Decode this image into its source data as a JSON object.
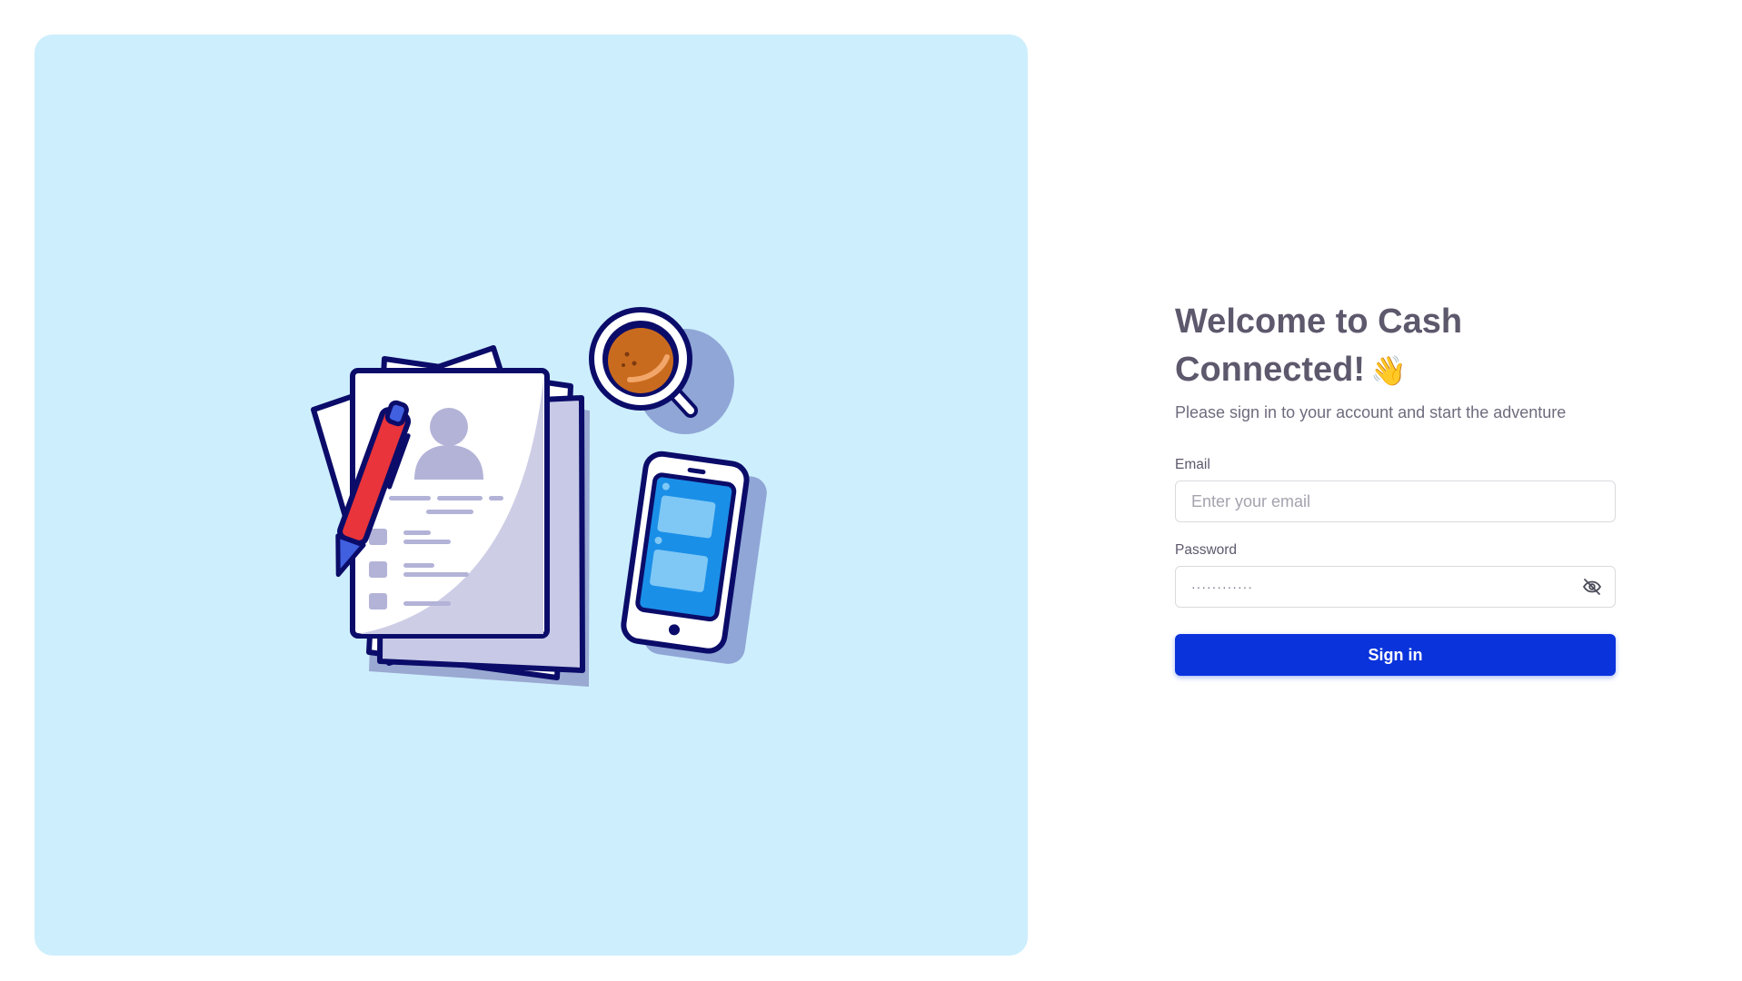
{
  "illustration": {
    "name": "documents-pen-coffee-phone-illustration",
    "panel_color": "#cdeefd"
  },
  "auth": {
    "title_line1": "Welcome to Cash",
    "title_line2": "Connected!",
    "wave_emoji": "👋",
    "subtitle": "Please sign in to your account and start the adventure",
    "email_label": "Email",
    "email_placeholder": "Enter your email",
    "email_value": "",
    "password_label": "Password",
    "password_value": "············",
    "password_toggle_icon": "eye-off-icon",
    "signin_label": "Sign in",
    "accent_color": "#0a33dc",
    "text_color": "#5d586c"
  }
}
